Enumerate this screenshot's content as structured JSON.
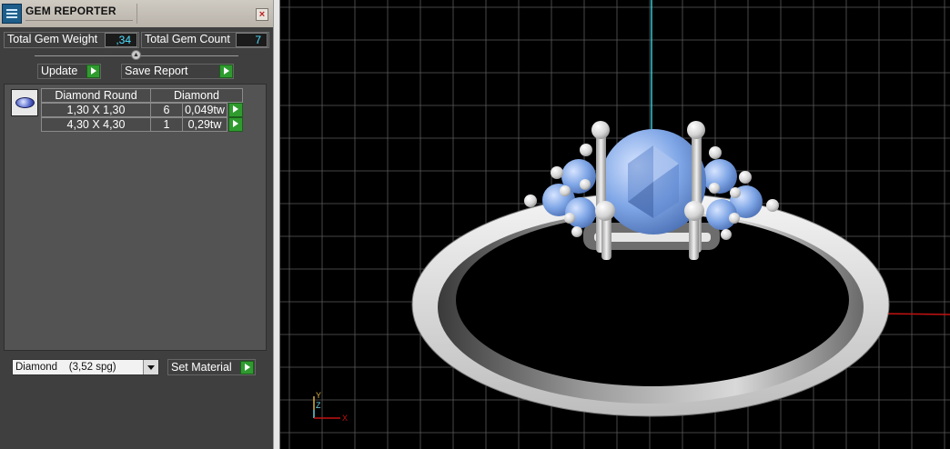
{
  "panel": {
    "title": "GEM REPORTER",
    "close_glyph": "×",
    "total_weight_label": "Total Gem Weight",
    "total_weight_value": ",34",
    "total_count_label": "Total Gem Count",
    "total_count_value": "7",
    "update_label": "Update",
    "save_report_label": "Save Report",
    "gem_table": {
      "headers": [
        "Diamond Round",
        "Diamond"
      ],
      "rows": [
        {
          "size": "1,30 X 1,30",
          "count": "6",
          "weight": "0,049tw"
        },
        {
          "size": "4,30 X 4,30",
          "count": "1",
          "weight": "0,29tw"
        }
      ]
    },
    "material_select": {
      "value": "Diamond    (3,52 spg)"
    },
    "set_material_label": "Set Material"
  },
  "viewport": {
    "axis_labels": {
      "x": "X",
      "y": "Y",
      "z": "Z"
    },
    "colors": {
      "grid": "#5a5a5a",
      "x_axis": "#c41212",
      "z_axis": "#2fc6d6",
      "gem": "#7fa6e6",
      "metal": "#dcdcdc"
    }
  }
}
